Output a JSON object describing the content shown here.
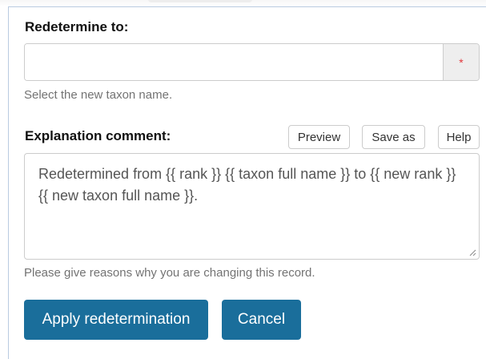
{
  "redetermine": {
    "label": "Redetermine to:",
    "value": "",
    "required_mark": "*",
    "help": "Select the new taxon name."
  },
  "explanation": {
    "label": "Explanation comment:",
    "buttons": {
      "preview": "Preview",
      "save_as": "Save as",
      "help": "Help"
    },
    "value": "Redetermined from {{ rank }} {{ taxon full name }} to {{ new rank }} {{ new taxon full name }}.",
    "help": "Please give reasons why you are changing this record."
  },
  "actions": {
    "apply": "Apply redetermination",
    "cancel": "Cancel"
  },
  "colors": {
    "primary": "#1a6e9b",
    "required": "#e2373b",
    "help_text": "#737373"
  }
}
